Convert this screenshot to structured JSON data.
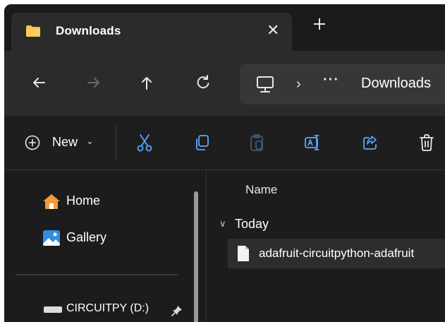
{
  "tab": {
    "title": "Downloads",
    "close_glyph": "✕"
  },
  "nav": {
    "buttons": [
      {
        "name": "back-button",
        "icon": "arrow-left-icon",
        "enabled": true
      },
      {
        "name": "forward-button",
        "icon": "arrow-right-icon",
        "enabled": false
      },
      {
        "name": "up-button",
        "icon": "arrow-up-icon",
        "enabled": true
      },
      {
        "name": "refresh-button",
        "icon": "refresh-icon",
        "enabled": true
      }
    ],
    "address": {
      "root_icon": "this-pc-icon",
      "separator": "›",
      "overflow": "···",
      "current": "Downloads"
    }
  },
  "commandbar": {
    "new_label": "New",
    "new_caret": "⌄",
    "actions": [
      "cut-icon",
      "copy-icon",
      "paste-icon",
      "rename-icon",
      "share-icon",
      "delete-icon"
    ]
  },
  "sidebar": {
    "items": [
      {
        "label": "Home",
        "icon": "home-icon"
      },
      {
        "label": "Gallery",
        "icon": "gallery-icon"
      }
    ],
    "drive": {
      "label": "CIRCUITPY (D:)",
      "icon": "drive-icon",
      "pinned": true
    }
  },
  "filelist": {
    "column_name": "Name",
    "group": {
      "label": "Today",
      "chevron": "∨"
    },
    "rows": [
      {
        "name": "adafruit-circuitpython-adafruit",
        "icon": "file-icon",
        "selected": true
      }
    ]
  },
  "colors": {
    "window_bg": "#1b1b1b",
    "tab_bg": "#2b2b2b",
    "address_bg": "#373737",
    "folder_yellow": "#f5c242",
    "home_orange": "#f29a3a",
    "gallery_blue": "#2f8fe0"
  }
}
